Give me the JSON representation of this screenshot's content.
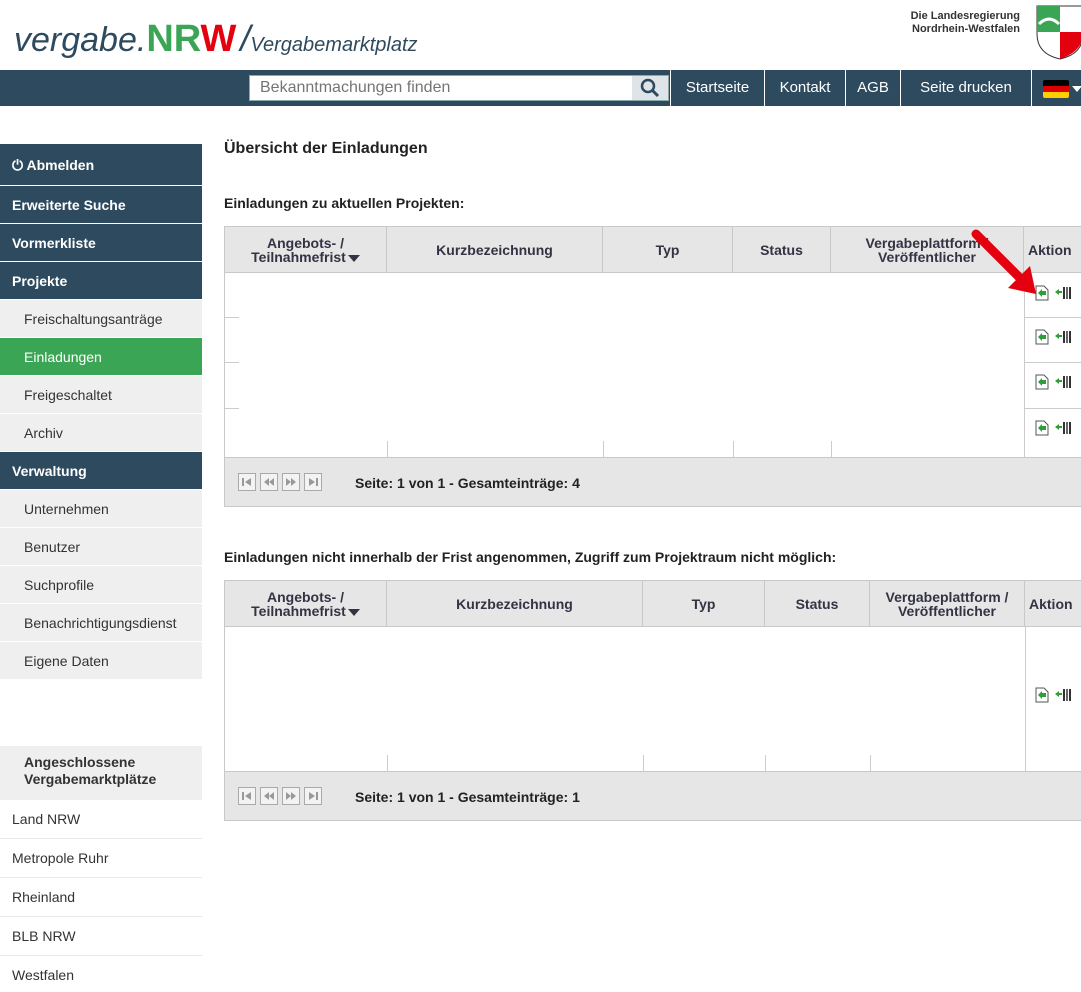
{
  "header": {
    "logo_vergabe": "vergabe.",
    "logo_nrw_n": "NR",
    "logo_nrw_w": "W",
    "logo_slash": "/",
    "logo_sub": "Vergabemarktplatz",
    "gov_line1": "Die Landesregierung",
    "gov_line2": "Nordrhein-Westfalen"
  },
  "nav": {
    "search_placeholder": "Bekanntmachungen finden",
    "links": [
      "Startseite",
      "Kontakt",
      "AGB",
      "Seite drucken"
    ]
  },
  "sidebar": {
    "logout": "Abmelden",
    "advanced_search": "Erweiterte Suche",
    "watchlist": "Vormerkliste",
    "projects": "Projekte",
    "project_items": [
      "Freischaltungsanträge",
      "Einladungen",
      "Freigeschaltet",
      "Archiv"
    ],
    "admin": "Verwaltung",
    "admin_items": [
      "Unternehmen",
      "Benutzer",
      "Suchprofile",
      "Benachrichtigungsdienst",
      "Eigene Daten"
    ],
    "connected_title": "Angeschlossene Vergabemarktplätze",
    "connected_items": [
      "Land NRW",
      "Metropole Ruhr",
      "Rheinland",
      "BLB NRW",
      "Westfalen"
    ]
  },
  "main": {
    "title": "Übersicht der Einladungen",
    "section1_title": "Einladungen zu aktuellen Projekten:",
    "section2_title": "Einladungen nicht innerhalb der Frist angenommen, Zugriff zum Projektraum nicht möglich:",
    "columns": {
      "deadline_line1": "Angebots- /",
      "deadline_line2": "Teilnahmefrist",
      "name": "Kurzbezeichnung",
      "type": "Typ",
      "status": "Status",
      "platform_line1": "Vergabeplattform /",
      "platform_line2": "Veröffentlicher",
      "action": "Aktion"
    },
    "pager1": "Seite: 1 von 1 - Gesamteinträge: 4",
    "pager2": "Seite: 1 von 1 - Gesamteinträge: 1"
  },
  "colors": {
    "navy": "#2e4a5e",
    "green": "#3aa655",
    "red": "#e3000f"
  }
}
